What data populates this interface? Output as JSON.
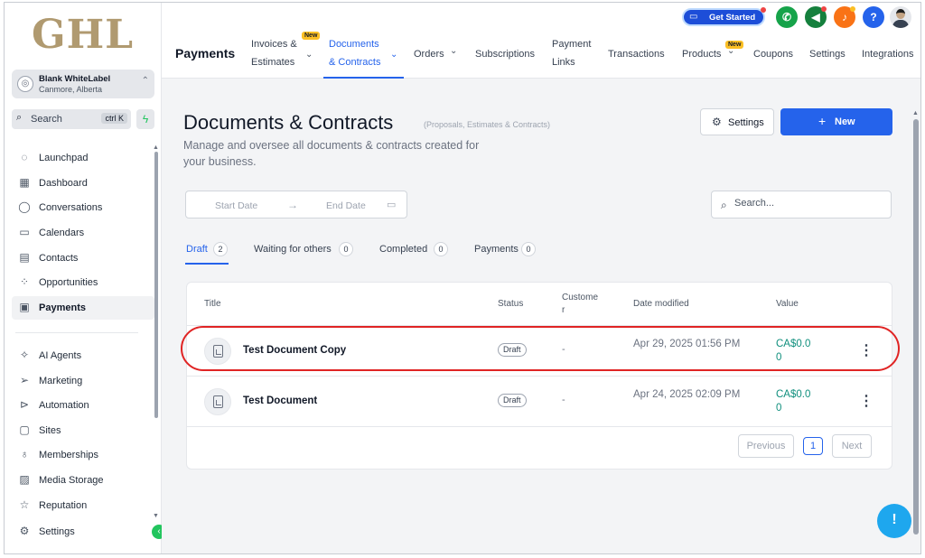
{
  "sidebar": {
    "logo": "GHL",
    "account": {
      "name": "Blank WhiteLabel",
      "location": "Canmore, Alberta"
    },
    "search": {
      "label": "Search",
      "shortcut": "ctrl K"
    },
    "items": [
      {
        "label": "Launchpad",
        "icon": "launchpad-icon"
      },
      {
        "label": "Dashboard",
        "icon": "dashboard-icon"
      },
      {
        "label": "Conversations",
        "icon": "chat-icon"
      },
      {
        "label": "Calendars",
        "icon": "calendar-icon"
      },
      {
        "label": "Contacts",
        "icon": "contacts-icon"
      },
      {
        "label": "Opportunities",
        "icon": "opportunities-icon"
      },
      {
        "label": "Payments",
        "icon": "payments-icon"
      }
    ],
    "items2": [
      {
        "label": "AI Agents",
        "icon": "sparkle-icon"
      },
      {
        "label": "Marketing",
        "icon": "send-icon"
      },
      {
        "label": "Automation",
        "icon": "automation-icon"
      },
      {
        "label": "Sites",
        "icon": "sites-icon"
      },
      {
        "label": "Memberships",
        "icon": "memberships-icon"
      },
      {
        "label": "Media Storage",
        "icon": "media-icon"
      },
      {
        "label": "Reputation",
        "icon": "star-icon"
      },
      {
        "label": "Settings",
        "icon": "gear-icon"
      }
    ]
  },
  "topbar": {
    "get_started": "Get Started",
    "page": "Payments",
    "new_badge": "New",
    "tabs": [
      {
        "line1": "Invoices &",
        "line2": "Estimates"
      },
      {
        "line1": "Documents",
        "line2": "& Contracts"
      },
      {
        "label": "Orders"
      },
      {
        "label": "Subscriptions"
      },
      {
        "line1": "Payment",
        "line2": "Links"
      },
      {
        "label": "Transactions"
      },
      {
        "label": "Products"
      },
      {
        "label": "Coupons"
      },
      {
        "label": "Settings"
      },
      {
        "label": "Integrations"
      }
    ],
    "help": "?"
  },
  "main": {
    "title": "Documents & Contracts",
    "subtitle": "(Proposals, Estimates & Contracts)",
    "description": "Manage and oversee all documents & contracts created for your business.",
    "settings_btn": "Settings",
    "new_btn": "New",
    "start_date": "Start Date",
    "end_date": "End Date",
    "search_placeholder": "Search...",
    "tabs": [
      {
        "label": "Draft",
        "count": "2"
      },
      {
        "label": "Waiting for others",
        "count": "0"
      },
      {
        "label": "Completed",
        "count": "0"
      },
      {
        "label": "Payments",
        "count": "0"
      }
    ],
    "table": {
      "headers": [
        "Title",
        "Status",
        "Custome r",
        "Date modified",
        "Value"
      ],
      "rows": [
        {
          "title": "Test Document Copy",
          "status": "Draft",
          "customer": "-",
          "date": "Apr 29, 2025 01:56 PM",
          "value": "CA$0.00"
        },
        {
          "title": "Test Document",
          "status": "Draft",
          "customer": "-",
          "date": "Apr 24, 2025 02:09 PM",
          "value": "CA$0.00"
        }
      ]
    },
    "pagination": {
      "prev": "Previous",
      "page": "1",
      "next": "Next"
    }
  },
  "colors": {
    "accent": "#2563eb",
    "value_green": "#0f8f7d",
    "highlight_red": "#e02424",
    "get_started": "#1d4ed8"
  }
}
